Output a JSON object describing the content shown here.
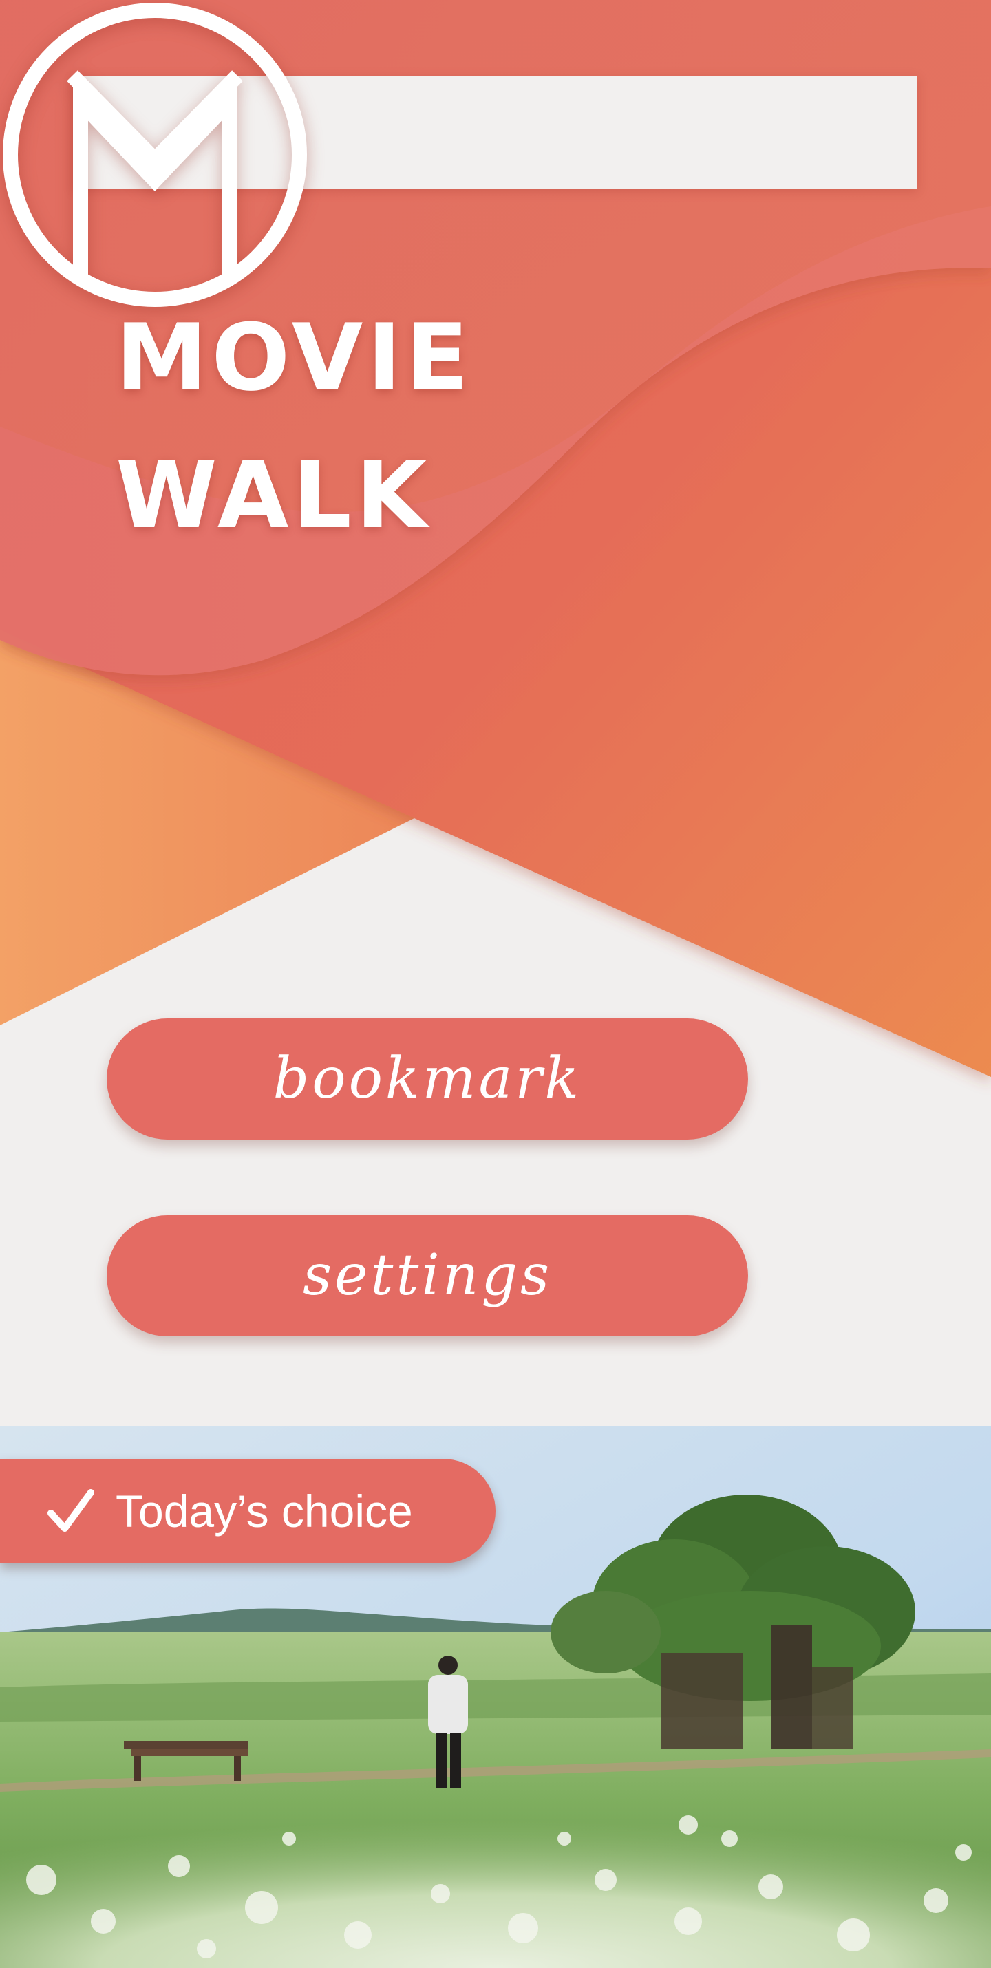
{
  "app": {
    "title_line1": "MOVIE",
    "title_line2": "WALK"
  },
  "search": {
    "placeholder": "",
    "value": ""
  },
  "logo": {
    "icon": "m-circle-logo-icon"
  },
  "menu": {
    "bookmark_label": "bookmark",
    "settings_label": "settings"
  },
  "todays_choice": {
    "label": "Today’s choice",
    "icon": "check-icon",
    "image": "scenic field with tree and person"
  },
  "colors": {
    "coral": "#e46b63",
    "orange": "#ec8b52",
    "background": "#f1efee",
    "white": "#ffffff"
  }
}
